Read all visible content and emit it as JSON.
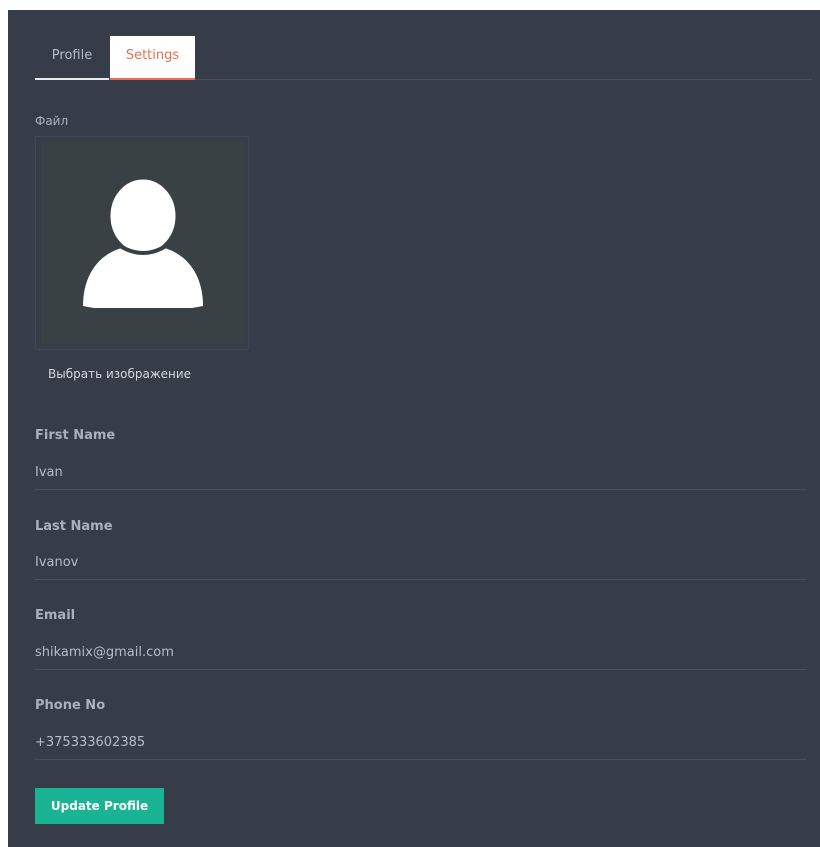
{
  "tabs": [
    {
      "label": "Profile"
    },
    {
      "label": "Settings"
    }
  ],
  "file": {
    "label": "Файл",
    "choose_label": "Выбрать изображение",
    "avatar_icon": "user-silhouette-icon"
  },
  "fields": {
    "first_name": {
      "label": "First Name",
      "value": "Ivan"
    },
    "last_name": {
      "label": "Last Name",
      "value": "Ivanov"
    },
    "email": {
      "label": "Email",
      "value": "shikamix@gmail.com"
    },
    "phone": {
      "label": "Phone No",
      "value": "+375333602385"
    }
  },
  "actions": {
    "update_label": "Update Profile"
  },
  "colors": {
    "background": "#363d48",
    "accent": "#1ab394",
    "active_tab": "#e6704f"
  }
}
